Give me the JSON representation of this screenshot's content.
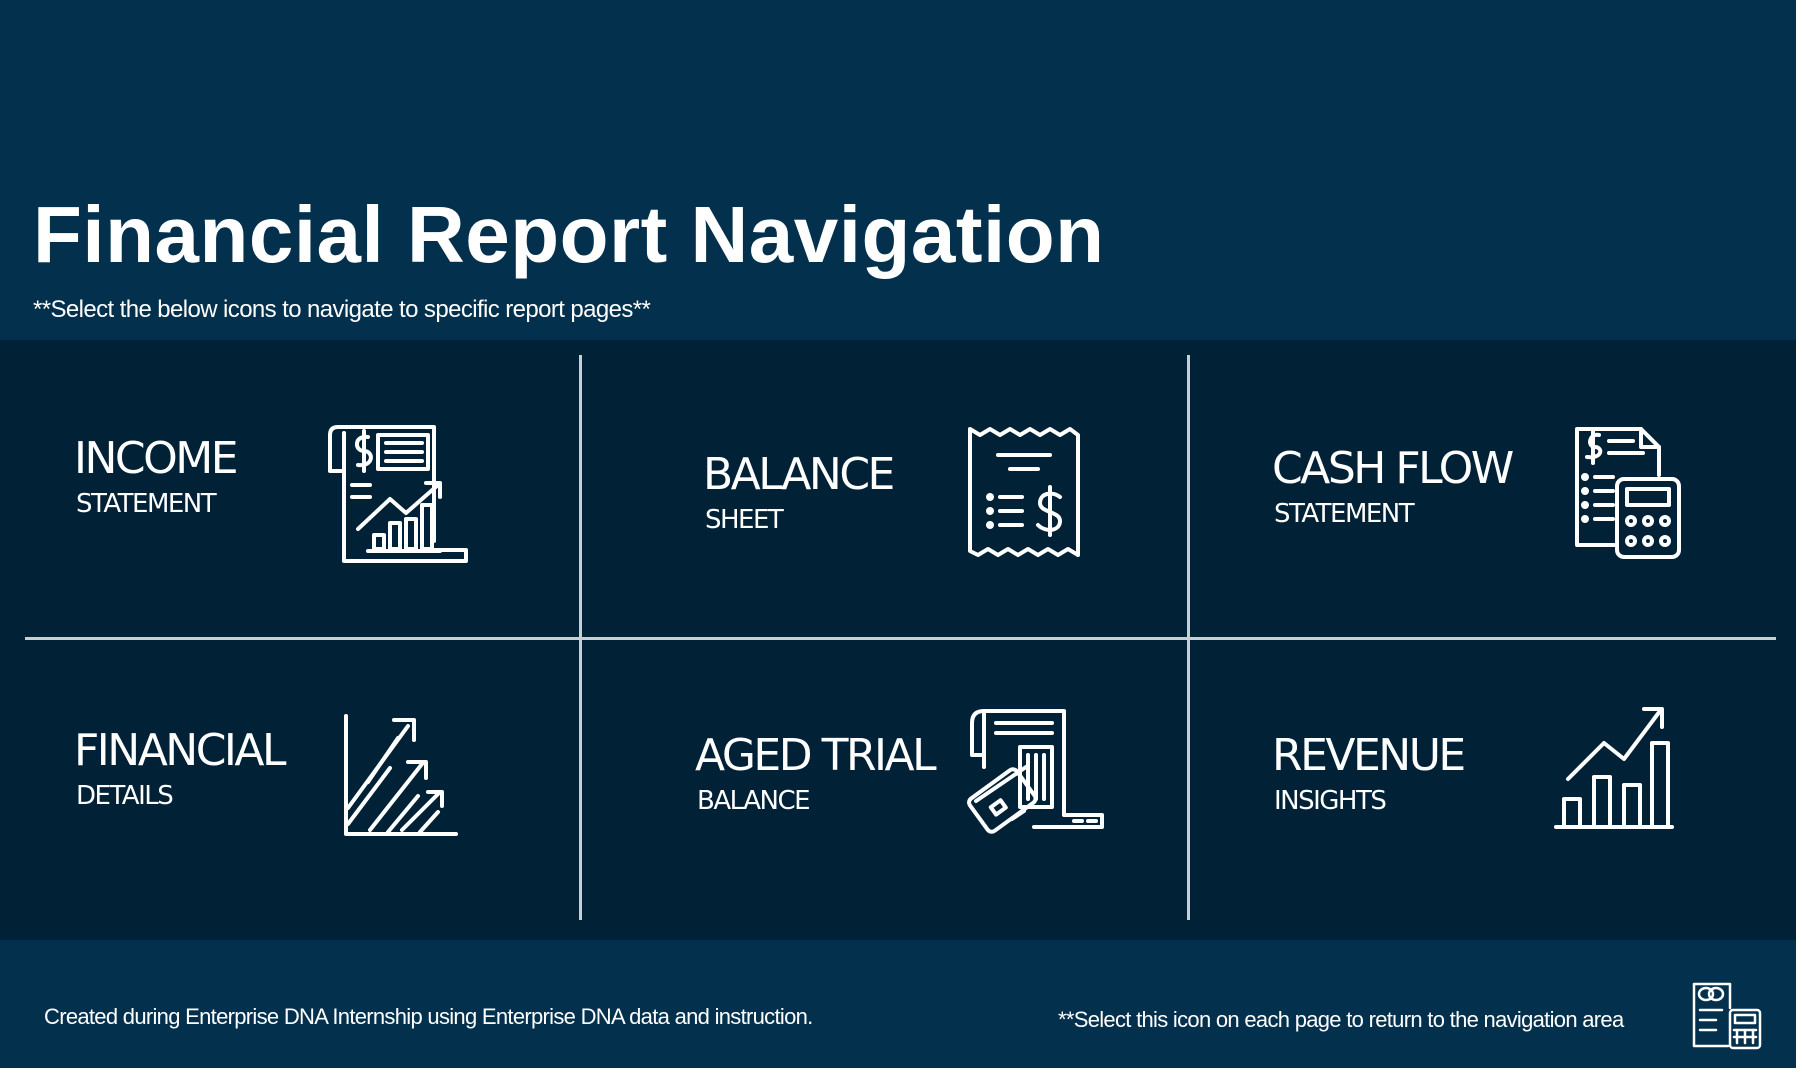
{
  "header": {
    "title": "Financial Report Navigation",
    "subtitle": "**Select the below icons to navigate to specific report pages**"
  },
  "tiles": [
    {
      "title": "INCOME",
      "subtitle": "STATEMENT",
      "icon": "income-statement-report-icon"
    },
    {
      "title": "BALANCE",
      "subtitle": "SHEET",
      "icon": "receipt-dollar-icon"
    },
    {
      "title": "CASH FLOW",
      "subtitle": "STATEMENT",
      "icon": "invoice-calculator-icon"
    },
    {
      "title": "FINANCIAL",
      "subtitle": "DETAILS",
      "icon": "growth-arrows-icon"
    },
    {
      "title": "AGED TRIAL",
      "subtitle": "BALANCE",
      "icon": "card-payment-terminal-icon"
    },
    {
      "title": "REVENUE",
      "subtitle": "INSIGHTS",
      "icon": "bar-chart-trend-icon"
    }
  ],
  "footer": {
    "credit": "Created during Enterprise DNA Internship using Enterprise DNA data and instruction.",
    "home_hint": "**Select this icon on each page to return to the navigation area",
    "home_icon": "home-navigation-icon"
  },
  "colors": {
    "header_background": "#03304d",
    "grid_background": "#012236",
    "divider": "#c9cfd4",
    "text": "#ffffff"
  }
}
